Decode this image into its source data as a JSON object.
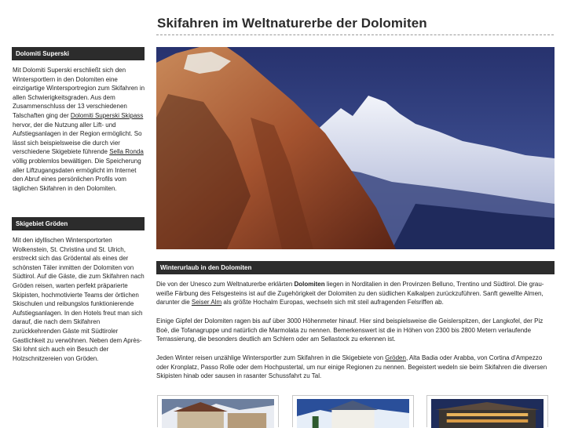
{
  "page": {
    "title": "Skifahren im Weltnaturerbe der Dolomiten"
  },
  "sidebar": {
    "section1": {
      "heading": "Dolomiti Superski",
      "text_before_link1": "Mit Dolomiti Superski erschließt sich den Wintersportlern in den Dolomiten eine einzigartige Wintersportregion zum Skifahren in allen Schwierigkeitsgraden. Aus dem Zusammenschluss der 13 verschiedenen Talschaften ging der ",
      "link1": "Dolomiti Superski Skipass",
      "text_between_links": " hervor, der die Nutzung aller Lift- und Aufstiegsanlagen in der Region ermöglicht. So lässt sich beispielsweise die durch vier verschiedene Skigebiete führende ",
      "link2": "Sella Ronda",
      "text_after_link2": " völlig problemlos bewältigen. Die Speicherung aller Liftzugangsdaten ermöglicht im Internet den Abruf eines persönlichen Profils vom täglichen Skifahren in den Dolomiten."
    },
    "section2": {
      "heading": "Skigebiet Gröden",
      "text": "Mit den idyllischen Wintersportorten Wolkenstein, St. Christina und St. Ulrich, erstreckt sich das Grödental als eines der schönsten Täler inmitten der Dolomiten von Südtirol. Auf die Gäste, die zum Skifahren nach Gröden reisen, warten perfekt präparierte Skipisten, hochmotivierte Teams der örtlichen Skischulen und reibungslos funktionierende Aufstiegsanlagen. In den Hotels freut man sich darauf, die nach dem Skifahren zurückkehrenden Gäste mit Südtiroler Gastlichkeit zu verwöhnen. Neben dem Après-Ski lohnt sich auch ein Besuch der Holzschnitzereien von Gröden."
    }
  },
  "main": {
    "heading": "Winterurlaub in den Dolomiten",
    "p1": {
      "before_bold": "Die von der Unesco zum Weltnaturerbe erklärten ",
      "bold": "Dolomiten",
      "after_bold": " liegen in Norditalien in den Provinzen Belluno, Trentino und Südtirol. Die grau-weiße Färbung des Felsgesteins ist auf die Zugehörigkeit der Dolomiten zu den südlichen Kalkalpen zurückzuführen. Sanft gewellte Almen, darunter die ",
      "link": "Seiser Alm",
      "after_link": " als größte Hochalm Europas, wechseln sich mit steil aufragenden Felsriffen ab."
    },
    "p2": "Einige Gipfel der Dolomiten ragen bis auf über 3000 Höhenmeter hinauf. Hier sind beispielsweise die Geislerspitzen, der Langkofel, der Piz Boè, die Tofanagruppe und natürlich die Marmolata zu nennen. Bemerkenswert ist die in Höhen von 2300 bis 2800 Metern verlaufende Terrassierung, die besonders deutlich am Schlern oder am Sellastock zu erkennen ist.",
    "p3": {
      "before_link": "Jeden Winter reisen unzählige Wintersportler zum Skifahren in die Skigebiete von ",
      "link": "Gröden",
      "after_link": ", Alta Badia oder Arabba, von Cortina d'Ampezzo oder Kronplatz, Passo Rolle oder dem Hochpustertal, um nur einige Regionen zu nennen. Begeistert wedeln sie beim Skifahren die diversen Skipisten hinab oder sausen in rasanter Schussfahrt zu Tal."
    }
  },
  "colors": {
    "heading_bar": "#2c2c2c",
    "sky": "#2f3f7c",
    "rock": "#b0603a"
  }
}
